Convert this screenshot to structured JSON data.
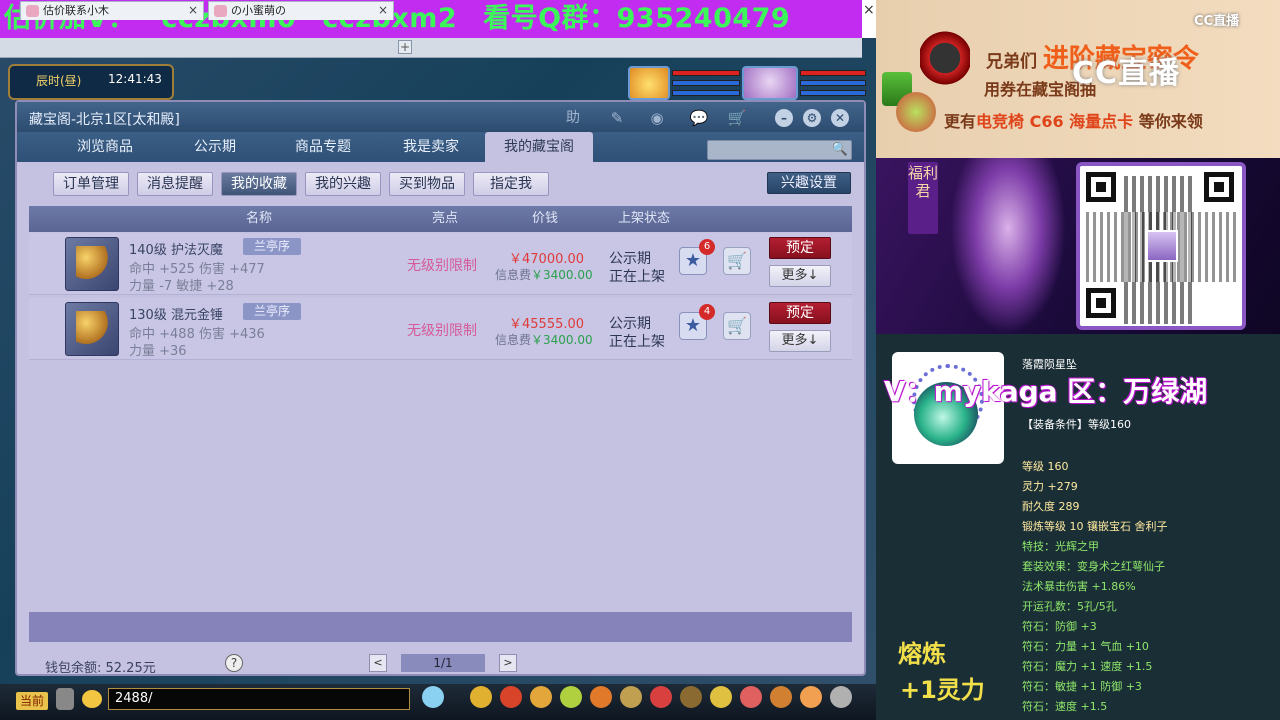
{
  "banner": {
    "segments": [
      "估价加V：",
      "cczbxm0",
      "cczbxm2",
      "看号Q群：935240479"
    ]
  },
  "browser": {
    "tabs": [
      "估价联系小木",
      "の小蜜萌の"
    ],
    "new_tab": "+",
    "close": "×"
  },
  "game": {
    "clock_label": "辰时(昼)",
    "clock_time": "12:41:43",
    "chat_value": "2488/",
    "current_label": "当前"
  },
  "window": {
    "title": "藏宝阁-北京1区[太和殿]",
    "help_label": "助",
    "tabs": [
      "浏览商品",
      "公示期",
      "商品专题",
      "我是卖家",
      "我的藏宝阁"
    ],
    "subtabs": [
      "订单管理",
      "消息提醒",
      "我的收藏",
      "我的兴趣",
      "买到物品",
      "指定我"
    ],
    "interest_settings": "兴趣设置",
    "columns": [
      "名称",
      "亮点",
      "价钱",
      "上架状态"
    ],
    "rows": [
      {
        "name": "140级 护法灭魔",
        "tag": "兰亭序",
        "stat1": "命中 +525 伤害 +477",
        "stat2": "力量 -7 敏捷 +28",
        "highlight": "无级别限制",
        "price": "￥47000.00",
        "fee_label": "信息费",
        "fee": "￥3400.00",
        "status1": "公示期",
        "status2": "正在上架",
        "fav_count": "6",
        "reserve": "预定",
        "more": "更多↓"
      },
      {
        "name": "130级 混元金锤",
        "tag": "兰亭序",
        "stat1": "命中 +488 伤害 +436",
        "stat2": "力量 +36",
        "highlight": "无级别限制",
        "price": "￥45555.00",
        "fee_label": "信息费",
        "fee": "￥3400.00",
        "status1": "公示期",
        "status2": "正在上架",
        "fav_count": "4",
        "reserve": "预定",
        "more": "更多↓"
      }
    ],
    "wallet": "钱包余额: 52.25元",
    "help": "?",
    "page": "1/1",
    "prev": "<",
    "next": ">"
  },
  "stream": {
    "ad_line1_prefix": "兄弟们",
    "ad_line1_big": "进阶藏宝密令",
    "ad_line2": "用券在藏宝阁抽",
    "ad_line3_prefix": "更有",
    "ad_line3_highlight": "电竞椅 C66 海量点卡",
    "ad_line3_suffix": "等你来领",
    "cc_logo": "CC直播",
    "cc_small": "CC直播",
    "fuli": "福利君",
    "overlay_v": "V：mykaga  区：万绿湖",
    "equip": {
      "name": "落霞陨星坠",
      "condition": "【装备条件】等级160",
      "level": "等级 160",
      "spirit": "灵力 +279",
      "durability": "耐久度 289",
      "forge": "锻炼等级 10 镶嵌宝石 舍利子",
      "special": "特技：光辉之甲",
      "set": "套装效果：变身术之红萼仙子",
      "crit": "法术暴击伤害 +1.86%",
      "holes": "开运孔数：5孔/5孔",
      "rune1": "符石：防御 +3",
      "rune2": "符石：力量 +1 气血 +10",
      "rune3": "符石：魔力 +1 速度 +1.5",
      "rune4": "符石：敏捷 +1 防御 +3",
      "rune5": "符石：速度 +1.5"
    },
    "smelt_title": "熔炼",
    "smelt_value": "+1灵力"
  }
}
